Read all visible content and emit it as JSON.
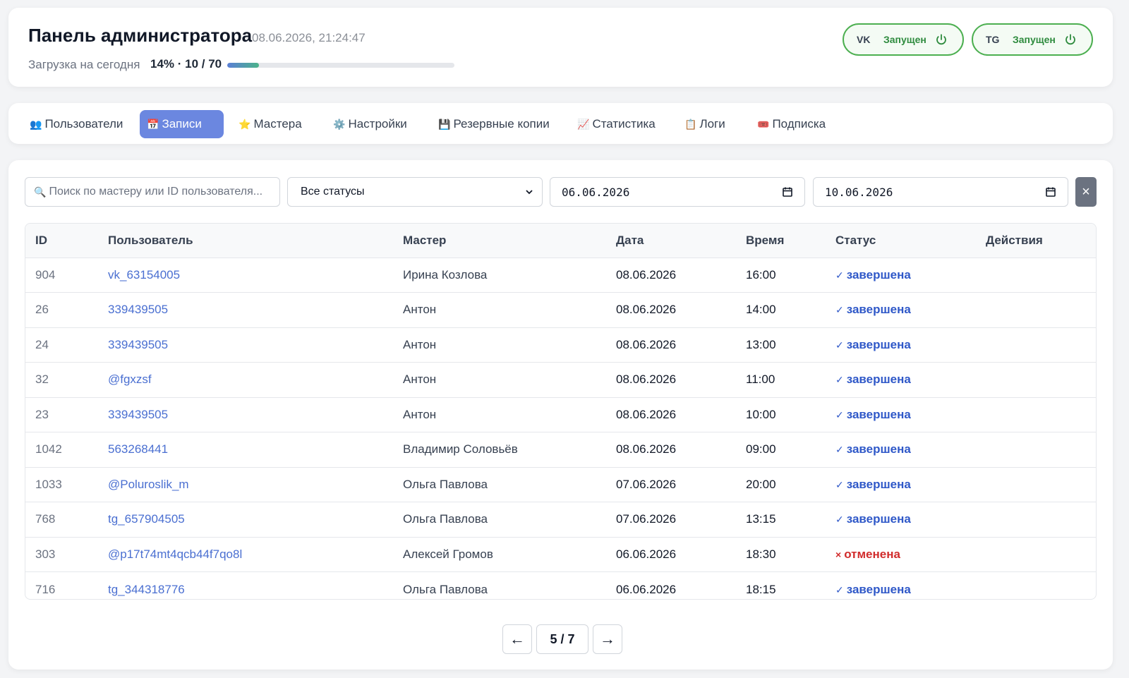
{
  "header": {
    "title": "Панель администратора",
    "timestamp": "08.06.2026, 21:24:47",
    "load_label": "Загрузка на сегодня",
    "load_value": "14% · 10 / 70",
    "load_fraction": 0.14
  },
  "services": [
    {
      "code": "VK",
      "state": "Запущен",
      "icon": "power-icon"
    },
    {
      "code": "TG",
      "state": "Запущен",
      "icon": "power-icon"
    }
  ],
  "tabs": [
    {
      "icon": "👥",
      "label": "Пользователи"
    },
    {
      "icon": "📅",
      "label": "Записи",
      "active": true
    },
    {
      "icon": "⭐",
      "label": "Мастера"
    },
    {
      "icon": "⚙️",
      "label": "Настройки"
    },
    {
      "icon": "💾",
      "label": "Резервные копии"
    },
    {
      "icon": "📈",
      "label": "Статистика"
    },
    {
      "icon": "📋",
      "label": "Логи"
    },
    {
      "icon": "🎟️",
      "label": "Подписка"
    }
  ],
  "filters": {
    "search_icon": "🔍",
    "search_placeholder": "Поиск по мастеру или ID пользователя...",
    "status_selected": "Все статусы",
    "date_from": "06.06.2026",
    "date_to": "10.06.2026",
    "clear_label": "×"
  },
  "table": {
    "columns": [
      "ID",
      "Пользователь",
      "Мастер",
      "Дата",
      "Время",
      "Статус",
      "Действия"
    ],
    "rows": [
      {
        "id": "904",
        "user": "vk_63154005",
        "master": "Ирина Козлова",
        "date": "08.06.2026",
        "time": "16:00",
        "status_mark": "✓",
        "status": "завершена",
        "status_kind": "done"
      },
      {
        "id": "26",
        "user": "339439505",
        "master": "Антон",
        "date": "08.06.2026",
        "time": "14:00",
        "status_mark": "✓",
        "status": "завершена",
        "status_kind": "done"
      },
      {
        "id": "24",
        "user": "339439505",
        "master": "Антон",
        "date": "08.06.2026",
        "time": "13:00",
        "status_mark": "✓",
        "status": "завершена",
        "status_kind": "done"
      },
      {
        "id": "32",
        "user": "@fgxzsf",
        "master": "Антон",
        "date": "08.06.2026",
        "time": "11:00",
        "status_mark": "✓",
        "status": "завершена",
        "status_kind": "done"
      },
      {
        "id": "23",
        "user": "339439505",
        "master": "Антон",
        "date": "08.06.2026",
        "time": "10:00",
        "status_mark": "✓",
        "status": "завершена",
        "status_kind": "done"
      },
      {
        "id": "1042",
        "user": "563268441",
        "master": "Владимир Соловьёв",
        "date": "08.06.2026",
        "time": "09:00",
        "status_mark": "✓",
        "status": "завершена",
        "status_kind": "done"
      },
      {
        "id": "1033",
        "user": "@Poluroslik_m",
        "master": "Ольга Павлова",
        "date": "07.06.2026",
        "time": "20:00",
        "status_mark": "✓",
        "status": "завершена",
        "status_kind": "done"
      },
      {
        "id": "768",
        "user": "tg_657904505",
        "master": "Ольга Павлова",
        "date": "07.06.2026",
        "time": "13:15",
        "status_mark": "✓",
        "status": "завершена",
        "status_kind": "done"
      },
      {
        "id": "303",
        "user": "@p17t74mt4qcb44f7qo8l",
        "master": "Алексей Громов",
        "date": "06.06.2026",
        "time": "18:30",
        "status_mark": "×",
        "status": "отменена",
        "status_kind": "cancel"
      },
      {
        "id": "716",
        "user": "tg_344318776",
        "master": "Ольга Павлова",
        "date": "06.06.2026",
        "time": "18:15",
        "status_mark": "✓",
        "status": "завершена",
        "status_kind": "done"
      }
    ]
  },
  "pagination": {
    "prev": "←",
    "info": "5 / 7",
    "next": "→"
  },
  "colors": {
    "accent": "#6b87e0",
    "running": "#4caf50",
    "done": "#2f58c8",
    "cancel": "#d12c2c",
    "link": "#4a6fd1"
  }
}
